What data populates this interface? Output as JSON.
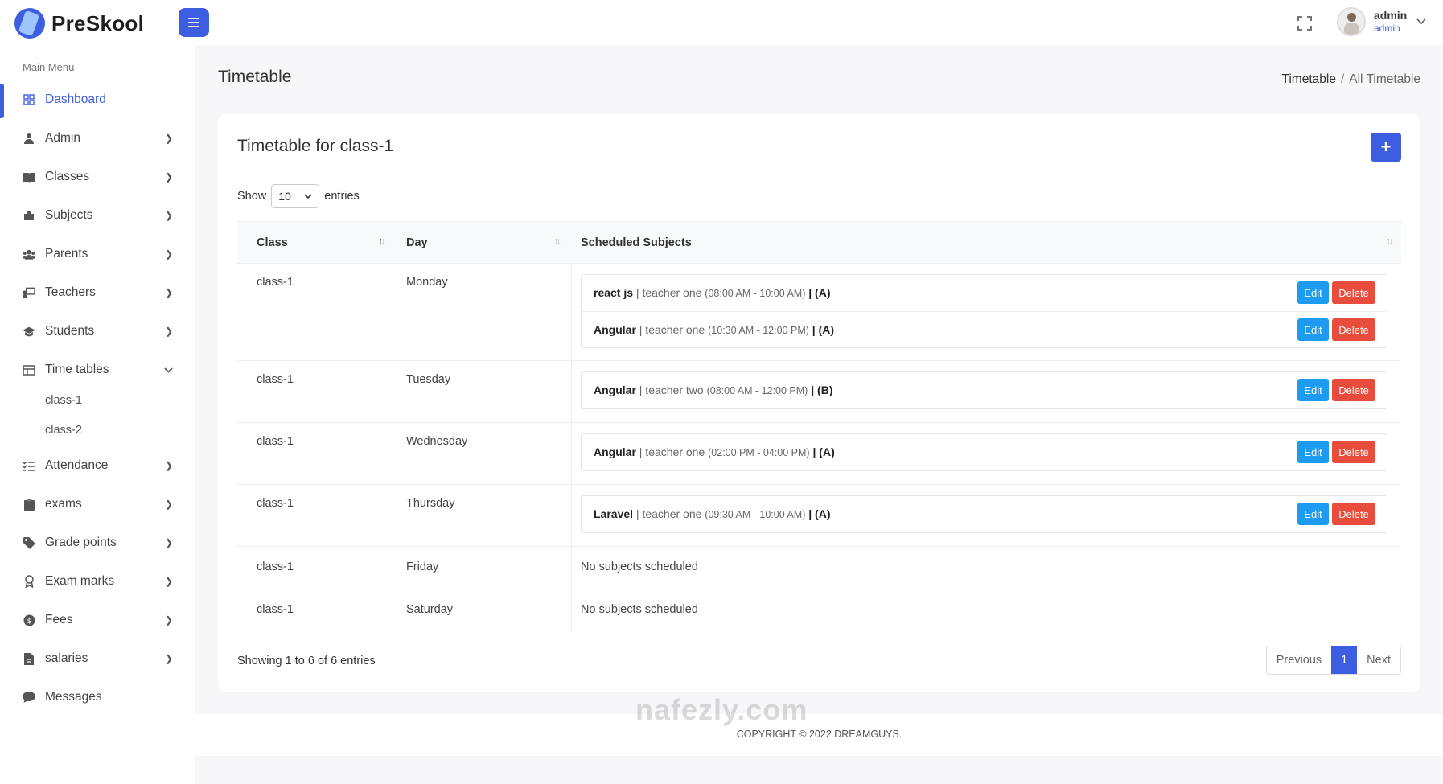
{
  "app": {
    "brand": "PreSkool"
  },
  "user": {
    "name": "admin",
    "role": "admin"
  },
  "sidebar": {
    "section_label": "Main Menu",
    "items": [
      {
        "label": "Dashboard",
        "icon": "grid-icon"
      },
      {
        "label": "Admin",
        "icon": "user-icon"
      },
      {
        "label": "Classes",
        "icon": "book-icon"
      },
      {
        "label": "Subjects",
        "icon": "puzzle-icon"
      },
      {
        "label": "Parents",
        "icon": "users-icon"
      },
      {
        "label": "Teachers",
        "icon": "chalkboard-icon"
      },
      {
        "label": "Students",
        "icon": "graduation-cap-icon"
      },
      {
        "label": "Time tables",
        "icon": "table-icon"
      },
      {
        "label": "Attendance",
        "icon": "list-check-icon"
      },
      {
        "label": "exams",
        "icon": "clipboard-icon"
      },
      {
        "label": "Grade points",
        "icon": "tag-icon"
      },
      {
        "label": "Exam marks",
        "icon": "award-icon"
      },
      {
        "label": "Fees",
        "icon": "coins-icon"
      },
      {
        "label": "salaries",
        "icon": "file-invoice-icon"
      },
      {
        "label": "Messages",
        "icon": "chat-icon"
      }
    ],
    "timetable_children": [
      "class-1",
      "class-2"
    ]
  },
  "page": {
    "title": "Timetable",
    "breadcrumb": {
      "parent": "Timetable",
      "separator": "/",
      "current": "All Timetable"
    }
  },
  "card": {
    "title": "Timetable for class-1",
    "show_label": "Show",
    "entries_value": "10",
    "entries_label": "entries",
    "columns": [
      "Class",
      "Day",
      "Scheduled Subjects"
    ],
    "rows": [
      {
        "class": "class-1",
        "day": "Monday",
        "subjects": [
          {
            "name": "react js",
            "teacher": " | teacher one ",
            "time": "(08:00 AM - 10:00 AM)",
            "section": " | (A)"
          },
          {
            "name": "Angular",
            "teacher": " | teacher one ",
            "time": "(10:30 AM - 12:00 PM)",
            "section": " | (A)"
          }
        ]
      },
      {
        "class": "class-1",
        "day": "Tuesday",
        "subjects": [
          {
            "name": "Angular",
            "teacher": " | teacher two ",
            "time": "(08:00 AM - 12:00 PM)",
            "section": " | (B)"
          }
        ]
      },
      {
        "class": "class-1",
        "day": "Wednesday",
        "subjects": [
          {
            "name": "Angular",
            "teacher": " | teacher one ",
            "time": "(02:00 PM - 04:00 PM)",
            "section": " | (A)"
          }
        ]
      },
      {
        "class": "class-1",
        "day": "Thursday",
        "subjects": [
          {
            "name": "Laravel",
            "teacher": " | teacher one ",
            "time": "(09:30 AM - 10:00 AM)",
            "section": " | (A)"
          }
        ]
      },
      {
        "class": "class-1",
        "day": "Friday",
        "empty": "No subjects scheduled"
      },
      {
        "class": "class-1",
        "day": "Saturday",
        "empty": "No subjects scheduled"
      }
    ],
    "edit_label": "Edit",
    "delete_label": "Delete",
    "showing": "Showing 1 to 6 of 6 entries",
    "pager": {
      "prev": "Previous",
      "page": "1",
      "next": "Next"
    }
  },
  "footer": {
    "text": "COPYRIGHT © 2022 DREAMGUYS."
  },
  "watermark": "nafezly.com",
  "colors": {
    "primary": "#3d5ee1",
    "edit": "#1d9bf0",
    "delete": "#e74c3c"
  }
}
